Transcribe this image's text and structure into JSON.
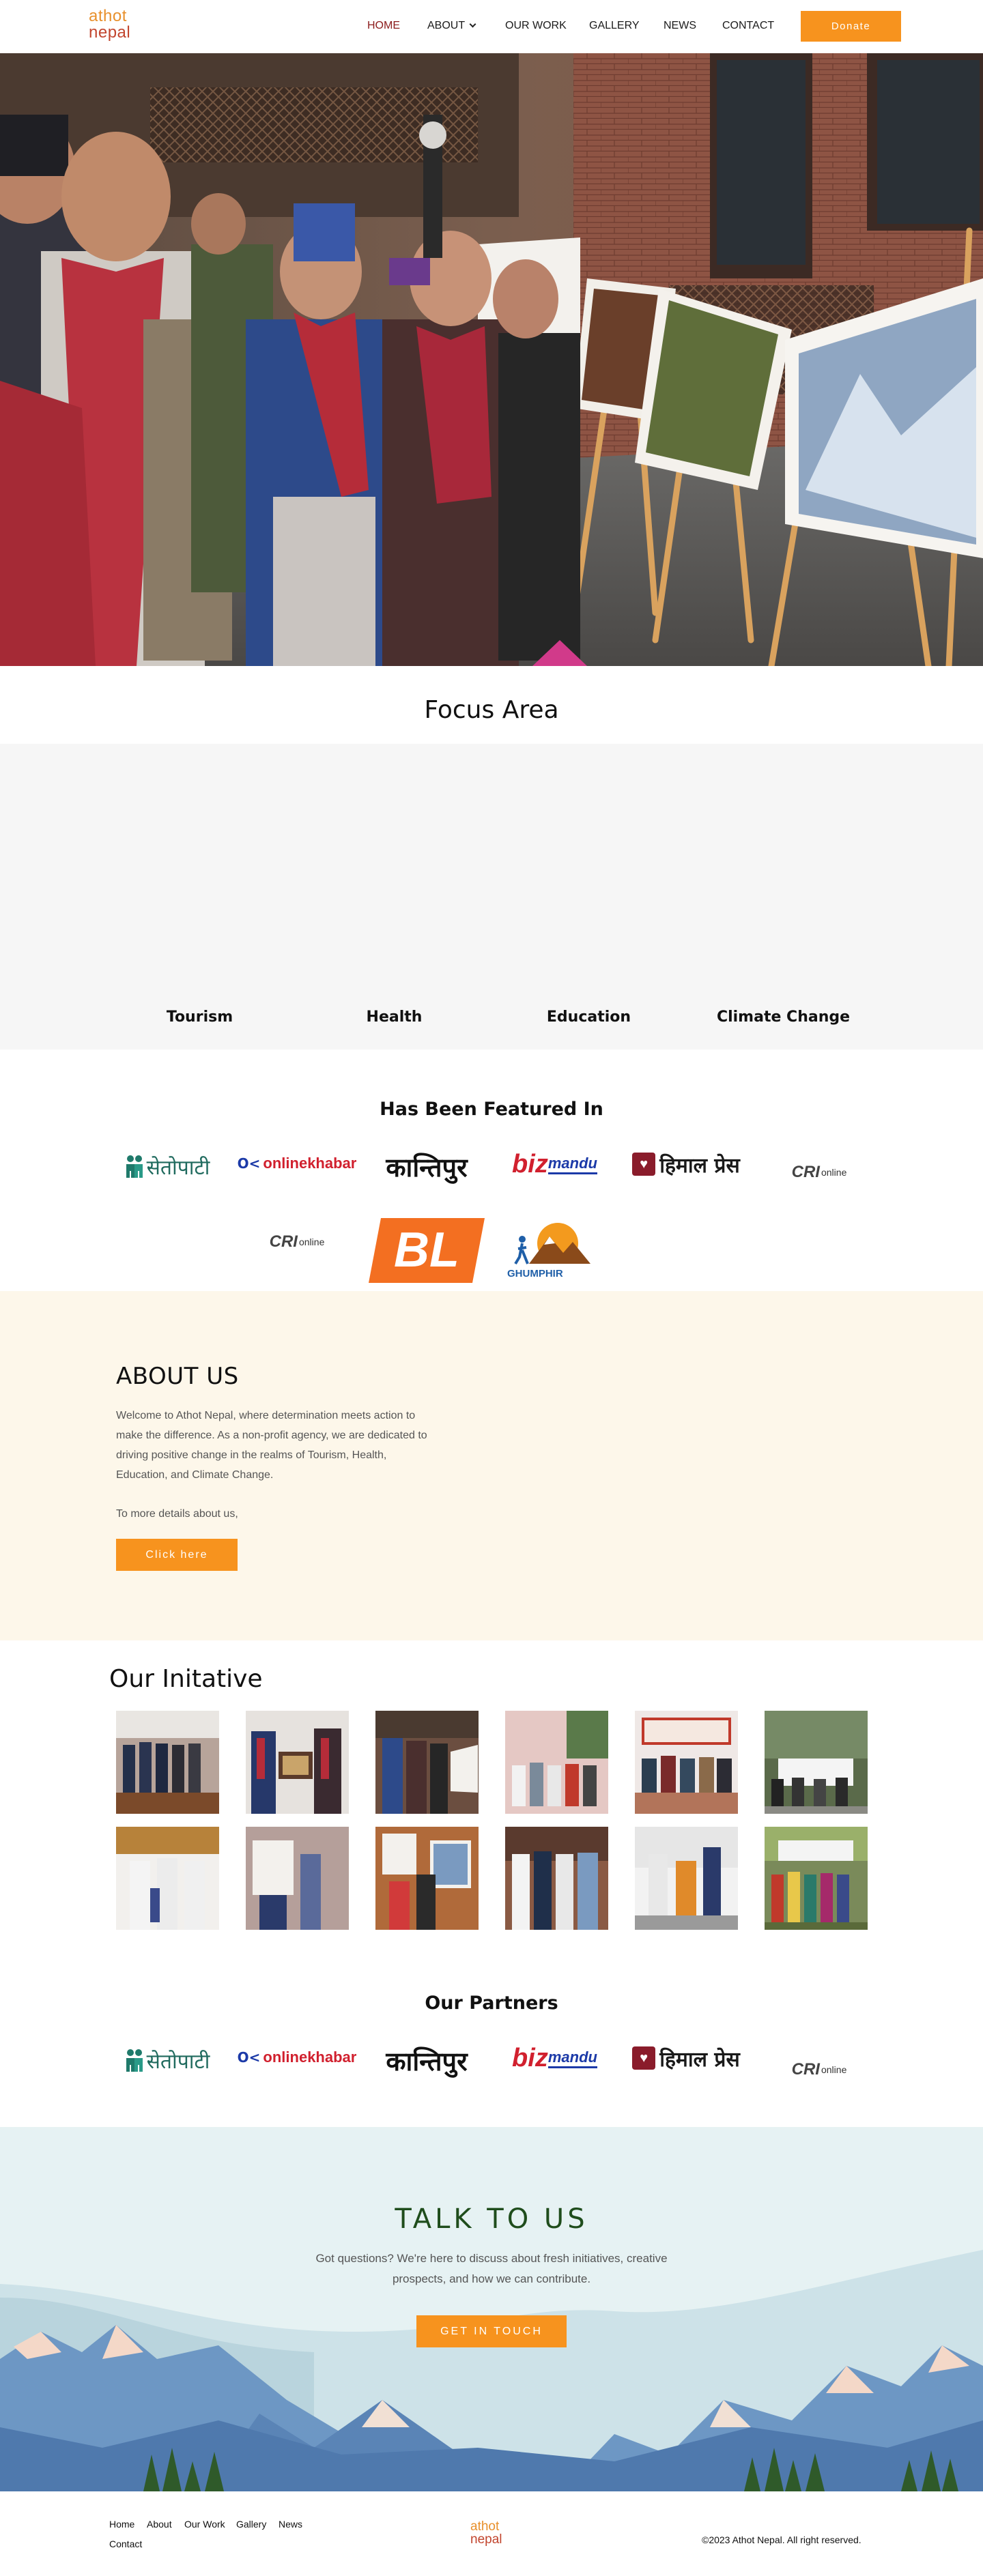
{
  "header": {
    "logo_line1": "athot",
    "logo_line2": "nepal",
    "nav": [
      "HOME",
      "ABOUT",
      "OUR WORK",
      "GALLERY",
      "NEWS",
      "CONTACT"
    ],
    "donate": "Donate",
    "accent": "#f7931e",
    "active_color": "#8b1a1a"
  },
  "focus": {
    "title": "Focus Area",
    "items": [
      "Tourism",
      "Health",
      "Education",
      "Climate Change"
    ]
  },
  "featured": {
    "title": "Has Been Featured In",
    "logos": {
      "setopati": "सेतोपाटी",
      "onlinekhabar": "onlinekhabar",
      "kantipur": "कान्तिपुर",
      "bizmandu_biz": "biz",
      "bizmandu_mandu": "mandu",
      "himal": "हिमाल प्रेस",
      "cri": "CRI",
      "cri_online": "online",
      "bl": "BL",
      "ghumphir": "GHUMPHIR"
    }
  },
  "about": {
    "title": "ABOUT US",
    "text": "Welcome to Athot Nepal, where determination meets action to make the difference. As a non-profit agency, we are dedicated to driving positive change in the realms of Tourism, Health, Education, and Climate Change.",
    "more": "To more details about us,",
    "button": "Click here"
  },
  "initiative": {
    "title": "Our Initative"
  },
  "partners": {
    "title": "Our Partners"
  },
  "talk": {
    "title": "TALK TO US",
    "text": "Got questions? We're here to discuss about fresh initiatives, creative prospects, and how we can contribute.",
    "button": "GET IN TOUCH"
  },
  "footer": {
    "links": [
      "Home",
      "About",
      "Our Work",
      "Gallery",
      "News",
      "Contact"
    ],
    "logo_line1": "athot",
    "logo_line2": "nepal",
    "copyright": "©2023 Athot Nepal. All right reserved."
  }
}
